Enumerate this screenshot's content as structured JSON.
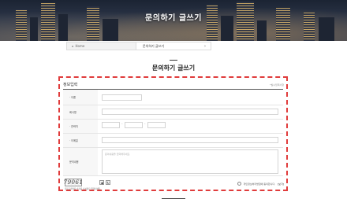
{
  "hero": {
    "title": "문의하기 글쓰기"
  },
  "breadcrumb": {
    "home": "Home",
    "current": "문의하기 글쓰기"
  },
  "page": {
    "title": "문의하기 글쓰기"
  },
  "form": {
    "section_title": "정보입력",
    "required_note": "*필수입력사항",
    "fields": [
      {
        "label": "· 이름"
      },
      {
        "label": "회사명"
      },
      {
        "label": "· 연락처"
      },
      {
        "label": "· 이메일"
      },
      {
        "label": "문의내용",
        "placeholder": "문의내용을 입력해주세요."
      }
    ],
    "captcha": {
      "text": "79061",
      "note": "자동등록방지 숫자를 순서대로 입력하세요."
    },
    "agree": {
      "label": "개인정보처리방침에 동의합니다.",
      "link": "[보기]"
    }
  },
  "colors": {
    "highlight": "#e03c3c",
    "hero_bg": "#2b3447"
  },
  "icons": {
    "home": "home-icon",
    "chevron": "chevron-down-icon",
    "sound": "speaker-icon",
    "refresh": "refresh-icon"
  }
}
